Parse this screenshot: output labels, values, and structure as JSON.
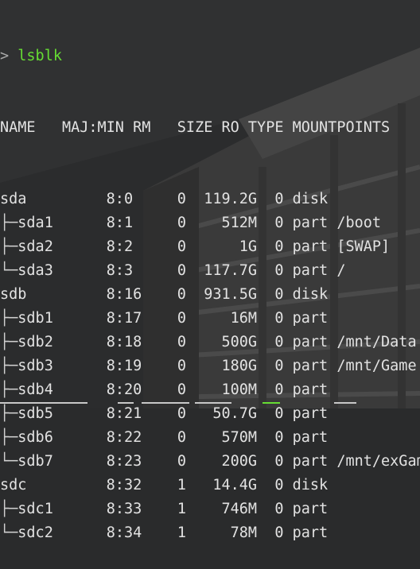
{
  "prompt": {
    "symbol": ">",
    "command": "lsblk"
  },
  "header": [
    "NAME",
    "MAJ:MIN",
    "RM",
    "SIZE",
    "RO",
    "TYPE",
    "MOUNTPOINTS"
  ],
  "rows": [
    {
      "tree": "",
      "name": "sda",
      "majmin": "8:0",
      "rm": "0",
      "size": "119.2G",
      "ro": "0",
      "type": "disk",
      "mount": ""
    },
    {
      "tree": "├─",
      "name": "sda1",
      "majmin": "8:1",
      "rm": "0",
      "size": "512M",
      "ro": "0",
      "type": "part",
      "mount": "/boot"
    },
    {
      "tree": "├─",
      "name": "sda2",
      "majmin": "8:2",
      "rm": "0",
      "size": "1G",
      "ro": "0",
      "type": "part",
      "mount": "[SWAP]"
    },
    {
      "tree": "└─",
      "name": "sda3",
      "majmin": "8:3",
      "rm": "0",
      "size": "117.7G",
      "ro": "0",
      "type": "part",
      "mount": "/"
    },
    {
      "tree": "",
      "name": "sdb",
      "majmin": "8:16",
      "rm": "0",
      "size": "931.5G",
      "ro": "0",
      "type": "disk",
      "mount": ""
    },
    {
      "tree": "├─",
      "name": "sdb1",
      "majmin": "8:17",
      "rm": "0",
      "size": "16M",
      "ro": "0",
      "type": "part",
      "mount": ""
    },
    {
      "tree": "├─",
      "name": "sdb2",
      "majmin": "8:18",
      "rm": "0",
      "size": "500G",
      "ro": "0",
      "type": "part",
      "mount": "/mnt/Data"
    },
    {
      "tree": "├─",
      "name": "sdb3",
      "majmin": "8:19",
      "rm": "0",
      "size": "180G",
      "ro": "0",
      "type": "part",
      "mount": "/mnt/Game"
    },
    {
      "tree": "├─",
      "name": "sdb4",
      "majmin": "8:20",
      "rm": "0",
      "size": "100M",
      "ro": "0",
      "type": "part",
      "mount": ""
    },
    {
      "tree": "├─",
      "name": "sdb5",
      "majmin": "8:21",
      "rm": "0",
      "size": "50.7G",
      "ro": "0",
      "type": "part",
      "mount": ""
    },
    {
      "tree": "├─",
      "name": "sdb6",
      "majmin": "8:22",
      "rm": "0",
      "size": "570M",
      "ro": "0",
      "type": "part",
      "mount": ""
    },
    {
      "tree": "└─",
      "name": "sdb7",
      "majmin": "8:23",
      "rm": "0",
      "size": "200G",
      "ro": "0",
      "type": "part",
      "mount": "/mnt/exGame"
    },
    {
      "tree": "",
      "name": "sdc",
      "majmin": "8:32",
      "rm": "1",
      "size": "14.4G",
      "ro": "0",
      "type": "disk",
      "mount": ""
    },
    {
      "tree": "├─",
      "name": "sdc1",
      "majmin": "8:33",
      "rm": "1",
      "size": "746M",
      "ro": "0",
      "type": "part",
      "mount": ""
    },
    {
      "tree": "└─",
      "name": "sdc2",
      "majmin": "8:34",
      "rm": "1",
      "size": "78M",
      "ro": "0",
      "type": "part",
      "mount": ""
    }
  ],
  "colors": {
    "background": "#2a2b2c",
    "text": "#e2e2e2",
    "command": "#66dd33",
    "prompt": "#a8a8a8"
  }
}
